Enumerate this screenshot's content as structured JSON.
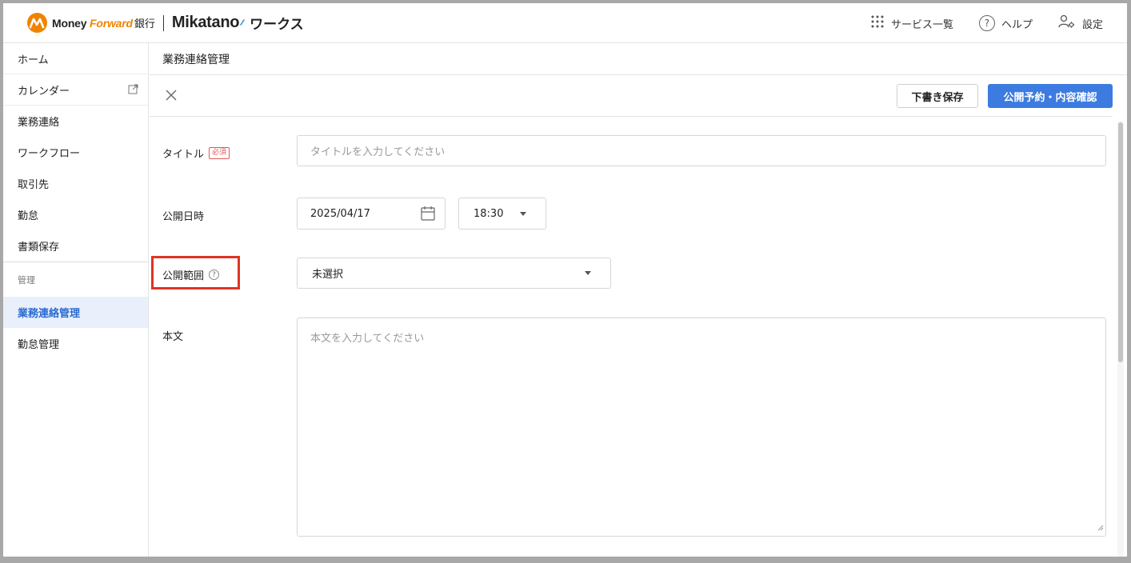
{
  "header": {
    "brand_money": "Money ",
    "brand_forward": "Forward",
    "brand_bank": "銀行",
    "brand_mikatano": "Mikatano",
    "brand_works": "ワークス",
    "services_label": "サービス一覧",
    "help_label": "ヘルプ",
    "settings_label": "設定"
  },
  "sidebar": {
    "items": [
      {
        "label": "ホーム"
      },
      {
        "label": "カレンダー"
      },
      {
        "label": "業務連絡"
      },
      {
        "label": "ワークフロー"
      },
      {
        "label": "取引先"
      },
      {
        "label": "勤怠"
      },
      {
        "label": "書類保存"
      }
    ],
    "section_label": "管理",
    "admin_items": [
      {
        "label": "業務連絡管理"
      },
      {
        "label": "勤怠管理"
      }
    ]
  },
  "main": {
    "page_title": "業務連絡管理",
    "toolbar": {
      "draft_label": "下書き保存",
      "publish_label": "公開予約・内容確認"
    },
    "form": {
      "title_label": "タイトル",
      "required_badge": "必須",
      "title_placeholder": "タイトルを入力してください",
      "publish_datetime_label": "公開日時",
      "publish_date": "2025/04/17",
      "publish_time": "18:30",
      "scope_label": "公開範囲",
      "scope_value": "未選択",
      "body_label": "本文",
      "body_placeholder": "本文を入力してください"
    }
  },
  "colors": {
    "brand_orange": "#f08300",
    "primary_blue": "#3c7be0",
    "highlight_red": "#e03325"
  }
}
